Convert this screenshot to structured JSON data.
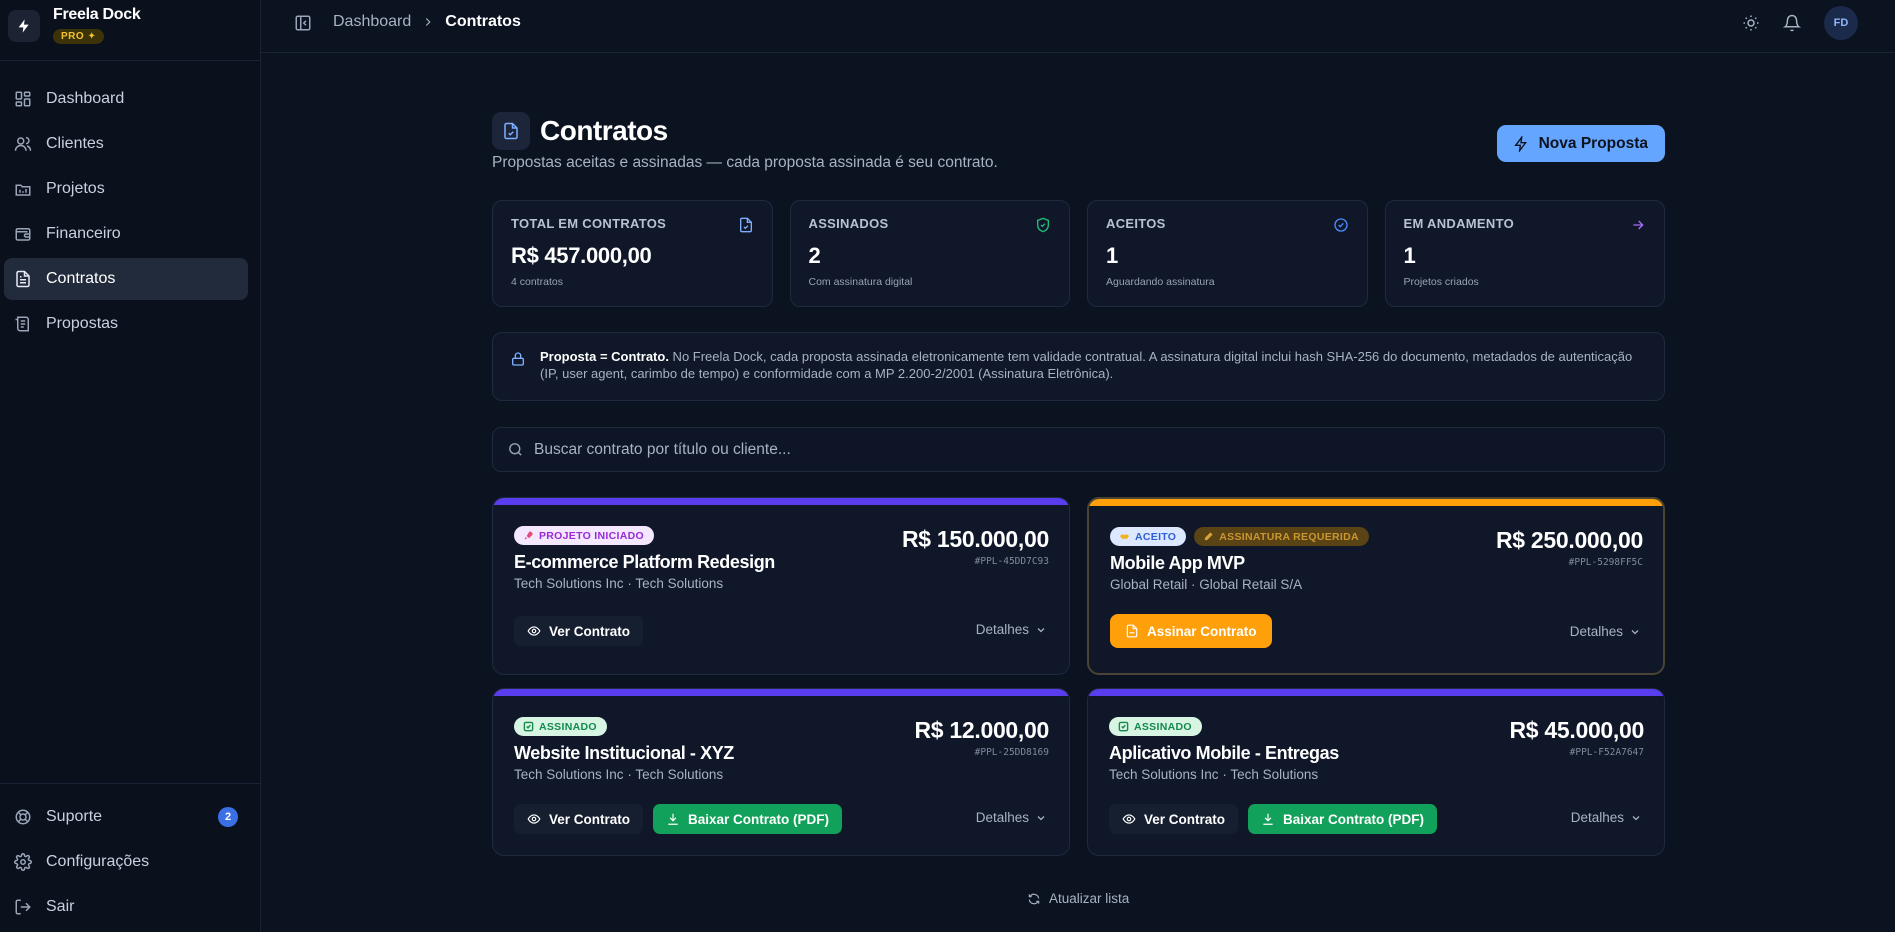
{
  "app": {
    "name": "Freela Dock",
    "plan_badge": "PRO ✦"
  },
  "sidebar": {
    "items": [
      {
        "label": "Dashboard",
        "icon": "dashboard-icon"
      },
      {
        "label": "Clientes",
        "icon": "users-icon"
      },
      {
        "label": "Projetos",
        "icon": "projects-icon"
      },
      {
        "label": "Financeiro",
        "icon": "wallet-icon"
      },
      {
        "label": "Contratos",
        "icon": "document-icon",
        "active": true
      },
      {
        "label": "Propostas",
        "icon": "proposal-icon"
      }
    ],
    "bottom": [
      {
        "label": "Suporte",
        "icon": "lifebuoy-icon",
        "badge": "2"
      },
      {
        "label": "Configurações",
        "icon": "gear-icon"
      },
      {
        "label": "Sair",
        "icon": "logout-icon"
      }
    ]
  },
  "topbar": {
    "breadcrumb_parent": "Dashboard",
    "breadcrumb_current": "Contratos",
    "avatar_initials": "FD"
  },
  "page": {
    "title": "Contratos",
    "subtitle": "Propostas aceitas e assinadas — cada proposta assinada é seu contrato.",
    "new_button": "Nova Proposta"
  },
  "stats": [
    {
      "label": "TOTAL EM CONTRATOS",
      "value": "R$ 457.000,00",
      "sub": "4 contratos",
      "icon": "document-check-icon",
      "color": "#7fb0ff"
    },
    {
      "label": "ASSINADOS",
      "value": "2",
      "sub": "Com assinatura digital",
      "icon": "shield-check-icon",
      "color": "#22c07a"
    },
    {
      "label": "ACEITOS",
      "value": "1",
      "sub": "Aguardando assinatura",
      "icon": "check-circle-icon",
      "color": "#4d8dff"
    },
    {
      "label": "EM ANDAMENTO",
      "value": "1",
      "sub": "Projetos criados",
      "icon": "arrow-right-icon",
      "color": "#a86bff"
    }
  ],
  "notice": {
    "strong": "Proposta = Contrato.",
    "text": " No Freela Dock, cada proposta assinada eletronicamente tem validade contratual. A assinatura digital inclui hash SHA-256 do documento, metadados de autenticação (IP, user agent, carimbo de tempo) e conformidade com a MP 2.200-2/2001 (Assinatura Eletrônica)."
  },
  "search": {
    "placeholder": "Buscar contrato por título ou cliente..."
  },
  "contracts": [
    {
      "badges": [
        {
          "label": "PROJETO INICIADO",
          "bg": "#f3e8ff",
          "fg": "#9b2ad6",
          "icon": "rocket-icon"
        }
      ],
      "title": "E-commerce Platform Redesign",
      "client": "Tech Solutions Inc · Tech Solutions",
      "amount": "R$ 150.000,00",
      "id": "#PPL-45DD7C93",
      "bar_color": "#5b3df0",
      "view_label": "Ver Contrato",
      "details_label": "Detalhes"
    },
    {
      "badges": [
        {
          "label": "ACEITO",
          "bg": "#dbe8ff",
          "fg": "#2f5fd6",
          "icon": "handshake-icon"
        },
        {
          "label": "ASSINATURA REQUERIDA",
          "bg": "#5a4315",
          "fg": "#c99630",
          "icon": "pen-icon"
        }
      ],
      "title": "Mobile App MVP",
      "client": "Global Retail · Global Retail S/A",
      "amount": "R$ 250.000,00",
      "id": "#PPL-5298FF5C",
      "bar_color": "#ff9f0a",
      "sign_label": "Assinar Contrato",
      "details_label": "Detalhes"
    },
    {
      "badges": [
        {
          "label": "ASSINADO",
          "bg": "#d8f5e4",
          "fg": "#138a4c",
          "icon": "check-square-icon"
        }
      ],
      "title": "Website Institucional - XYZ",
      "client": "Tech Solutions Inc · Tech Solutions",
      "amount": "R$ 12.000,00",
      "id": "#PPL-25DD8169",
      "bar_color": "#5b3df0",
      "view_label": "Ver Contrato",
      "download_label": "Baixar Contrato (PDF)",
      "details_label": "Detalhes"
    },
    {
      "badges": [
        {
          "label": "ASSINADO",
          "bg": "#d8f5e4",
          "fg": "#138a4c",
          "icon": "check-square-icon"
        }
      ],
      "title": "Aplicativo Mobile - Entregas",
      "client": "Tech Solutions Inc · Tech Solutions",
      "amount": "R$ 45.000,00",
      "id": "#PPL-F52A7647",
      "bar_color": "#5b3df0",
      "view_label": "Ver Contrato",
      "download_label": "Baixar Contrato (PDF)",
      "details_label": "Detalhes"
    }
  ],
  "footer": {
    "refresh_label": "Atualizar lista"
  }
}
